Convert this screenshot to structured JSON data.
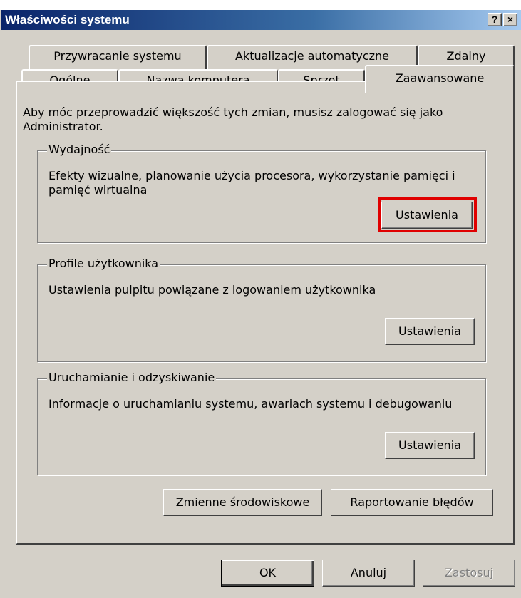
{
  "window": {
    "title": "Właściwości systemu",
    "help_button": "?",
    "close_button": "×"
  },
  "tabs": {
    "row_top": [
      {
        "label": "Przywracanie systemu"
      },
      {
        "label": "Aktualizacje automatyczne"
      },
      {
        "label": "Zdalny"
      }
    ],
    "row_bottom": [
      {
        "label": "Ogólne"
      },
      {
        "label": "Nazwa komputera"
      },
      {
        "label": "Sprzęt"
      },
      {
        "label": "Zaawansowane",
        "selected": true
      }
    ]
  },
  "intro_text": "Aby móc przeprowadzić większość tych zmian, musisz zalogować się jako Administrator.",
  "groups": {
    "performance": {
      "label": "Wydajność",
      "description": "Efekty wizualne, planowanie użycia procesora, wykorzystanie pamięci i pamięć wirtualna",
      "button": "Ustawienia"
    },
    "user_profiles": {
      "label": "Profile użytkownika",
      "description": "Ustawienia pulpitu powiązane z logowaniem użytkownika",
      "button": "Ustawienia"
    },
    "startup_recovery": {
      "label": "Uruchamianie i odzyskiwanie",
      "description": "Informacje o uruchamianiu systemu, awariach systemu i debugowaniu",
      "button": "Ustawienia"
    }
  },
  "buttons": {
    "env_vars": "Zmienne środowiskowe",
    "error_reporting": "Raportowanie błędów",
    "ok": "OK",
    "cancel": "Anuluj",
    "apply": "Zastosuj"
  },
  "colors": {
    "face": "#d4d0c8",
    "title_start": "#0a246a",
    "title_end": "#a6caf0",
    "highlight": "#e00000"
  }
}
